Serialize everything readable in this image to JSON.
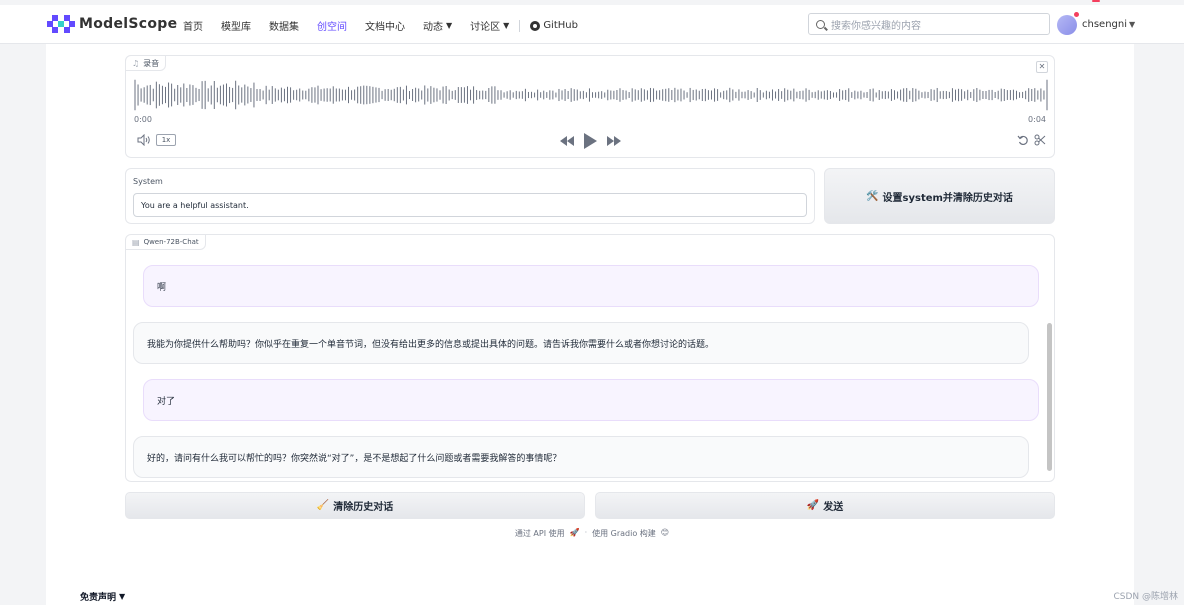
{
  "header": {
    "logo_text": "ModelScope",
    "nav": [
      {
        "label": "首页"
      },
      {
        "label": "模型库"
      },
      {
        "label": "数据集"
      },
      {
        "label": "创空间",
        "active": true
      },
      {
        "label": "文档中心"
      },
      {
        "label": "动态"
      },
      {
        "label": "讨论区"
      },
      {
        "label": "GitHub"
      }
    ],
    "search_placeholder": "搜索你感兴趣的内容",
    "username": "chsengni",
    "accent_color": "#624aff"
  },
  "audio": {
    "label": "录音",
    "time_start": "0:00",
    "time_end": "0:04",
    "playback_rate": "1x"
  },
  "system": {
    "label": "System",
    "value": "You are a helpful assistant.",
    "button_label": "设置system并清除历史对话",
    "button_icon": "🛠️"
  },
  "chatbot": {
    "label": "Qwen-72B-Chat",
    "messages": [
      {
        "role": "user",
        "text": "啊"
      },
      {
        "role": "bot",
        "text": "我能为你提供什么帮助吗？你似乎在重复一个单音节词，但没有给出更多的信息或提出具体的问题。请告诉我你需要什么或者你想讨论的话题。"
      },
      {
        "role": "user",
        "text": "对了"
      },
      {
        "role": "bot",
        "text": "好的，请问有什么我可以帮忙的吗？你突然说“对了”，是不是想起了什么问题或者需要我解答的事情呢？"
      }
    ]
  },
  "actions": {
    "clear_label": "清除历史对话",
    "clear_icon": "🧹",
    "send_label": "发送",
    "send_icon": "🚀"
  },
  "footer": {
    "api_text": "通过 API 使用",
    "api_icon": "🚀",
    "separator": "·",
    "gradio_text": "使用 Gradio 构建",
    "gradio_icon": "😊"
  },
  "disclaimer": "免责声明",
  "watermark": "CSDN @陈增林"
}
